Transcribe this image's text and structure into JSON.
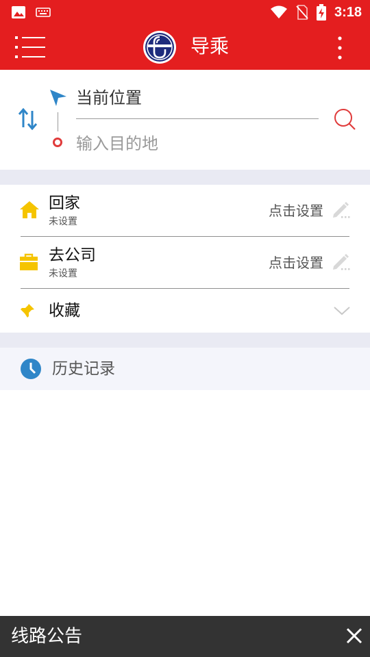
{
  "status_bar": {
    "time": "3:18"
  },
  "app_bar": {
    "title": "导乘"
  },
  "route": {
    "origin_value": "当前位置",
    "destination_placeholder": "输入目的地"
  },
  "places": [
    {
      "name": "回家",
      "status": "未设置",
      "action": "点击设置"
    },
    {
      "name": "去公司",
      "status": "未设置",
      "action": "点击设置"
    }
  ],
  "favorites": {
    "label": "收藏"
  },
  "history": {
    "label": "历史记录"
  },
  "notice": {
    "label": "线路公告"
  },
  "colors": {
    "primary_red": "#e41e1f",
    "accent_blue": "#2f86c8",
    "icon_yellow": "#f5c400",
    "notice_bg": "#333333"
  }
}
